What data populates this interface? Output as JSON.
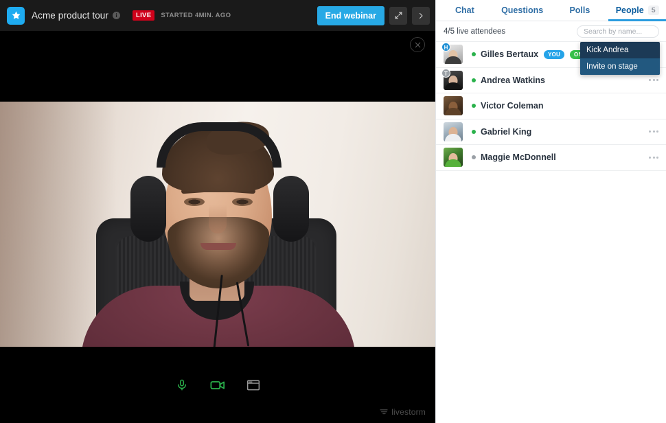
{
  "header": {
    "logo_icon": "star-icon",
    "title": "Acme product tour",
    "info_icon": "info-icon",
    "live_badge": "LIVE",
    "started_text": "STARTED 4MIN. AGO",
    "end_button": "End webinar",
    "expand_icon": "expand-arrows-icon",
    "next_icon": "chevron-right-icon",
    "accent_color": "#27a9e5",
    "live_color": "#d0021b"
  },
  "stage": {
    "close_icon": "close-circle-icon",
    "controls": [
      {
        "name": "microphone-icon",
        "label": "Microphone",
        "color": "#2bb24c"
      },
      {
        "name": "camera-icon",
        "label": "Camera",
        "color": "#2bb24c"
      },
      {
        "name": "screen-share-icon",
        "label": "Share screen",
        "color": "#9a9a9a"
      }
    ],
    "watermark": "livestorm",
    "watermark_icon": "livestorm-logo-icon"
  },
  "panel": {
    "tabs": [
      {
        "label": "Chat",
        "active": false,
        "count": ""
      },
      {
        "label": "Questions",
        "active": false,
        "count": ""
      },
      {
        "label": "Polls",
        "active": false,
        "count": ""
      },
      {
        "label": "People",
        "active": true,
        "count": "5"
      }
    ],
    "attendee_count": "4/5 live attendees",
    "search_placeholder": "Search by name...",
    "search_value": "",
    "attendees": [
      {
        "name": "Gilles Bertaux",
        "status": "online",
        "role_badge": "H",
        "role_type": "host",
        "avatar": "av-a",
        "pills": [
          {
            "label": "YOU",
            "type": "you"
          },
          {
            "label": "ON STAGE",
            "type": "stage"
          }
        ],
        "has_menu": false
      },
      {
        "name": "Andrea Watkins",
        "status": "online",
        "role_badge": "T",
        "role_type": "team",
        "avatar": "av-b",
        "pills": [],
        "has_menu": true
      },
      {
        "name": "Victor Coleman",
        "status": "online",
        "role_badge": "",
        "role_type": "",
        "avatar": "av-c",
        "pills": [],
        "has_menu": false
      },
      {
        "name": "Gabriel King",
        "status": "online",
        "role_badge": "",
        "role_type": "",
        "avatar": "av-d",
        "pills": [],
        "has_menu": true
      },
      {
        "name": "Maggie McDonnell",
        "status": "offline",
        "role_badge": "",
        "role_type": "",
        "avatar": "av-e",
        "pills": [],
        "has_menu": true
      }
    ],
    "context_menu": {
      "items": [
        {
          "label": "Kick Andrea",
          "highlight": false
        },
        {
          "label": "Invite on stage",
          "highlight": true
        }
      ]
    }
  }
}
